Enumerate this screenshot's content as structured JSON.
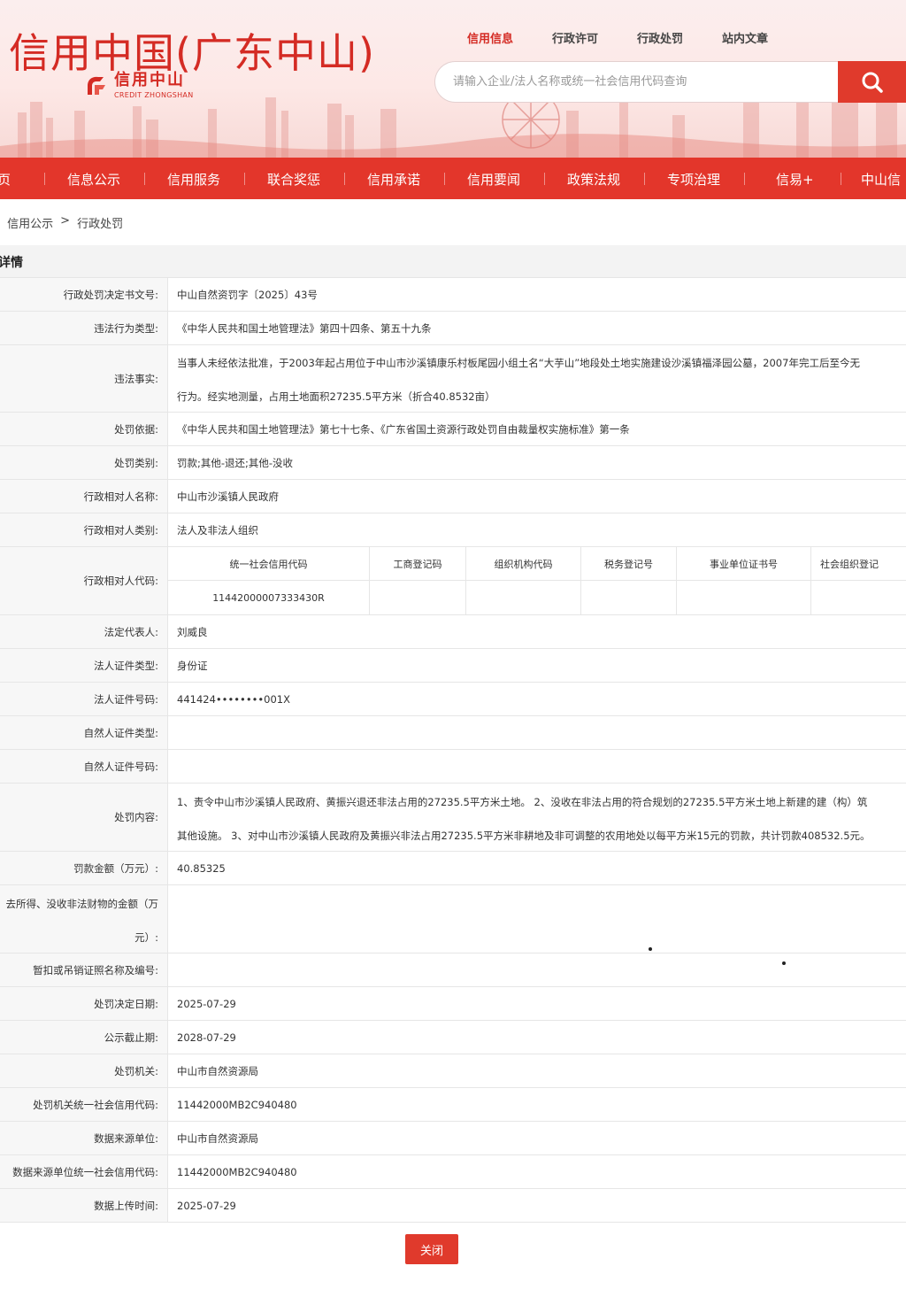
{
  "header": {
    "site_title": "信用中国(广东中山)",
    "logo_cn": "信用中山",
    "logo_en": "CREDIT ZHONGSHAN",
    "top_nav": [
      "信用信息",
      "行政许可",
      "行政处罚",
      "站内文章"
    ],
    "active_top_nav": "信用信息",
    "search_placeholder": "请输入企业/法人名称或统一社会信用代码查询"
  },
  "main_nav": [
    "页",
    "信息公示",
    "信用服务",
    "联合奖惩",
    "信用承诺",
    "信用要闻",
    "政策法规",
    "专项治理",
    "信易+",
    "中山信"
  ],
  "breadcrumb": [
    "信用公示",
    ">",
    "行政处罚"
  ],
  "breadcrumb_lead": "·",
  "detail_title": "详情",
  "rows": {
    "doc_no": {
      "label": "行政处罚决定书文号:",
      "value": "中山自然资罚字〔2025〕43号"
    },
    "violation_type": {
      "label": "违法行为类型:",
      "value": "《中华人民共和国土地管理法》第四十四条、第五十九条"
    },
    "facts": {
      "label": "违法事实:",
      "line1": "当事人未经依法批准，于2003年起占用位于中山市沙溪镇康乐村板尾园小组土名“大芋山”地段处土地实施建设沙溪镇福泽园公墓，2007年完工后至今无",
      "line2": "行为。经实地测量，占用土地面积27235.5平方米（折合40.8532亩）"
    },
    "basis": {
      "label": "处罚依据:",
      "value": "《中华人民共和国土地管理法》第七十七条、《广东省国土资源行政处罚自由裁量权实施标准》第一条"
    },
    "category": {
      "label": "处罚类别:",
      "value": "罚款;其他-退还;其他-没收"
    },
    "party_name": {
      "label": "行政相对人名称:",
      "value": "中山市沙溪镇人民政府"
    },
    "party_type": {
      "label": "行政相对人类别:",
      "value": "法人及非法人组织"
    },
    "party_code": {
      "label": "行政相对人代码:",
      "headers": [
        "统一社会信用代码",
        "工商登记码",
        "组织机构代码",
        "税务登记号",
        "事业单位证书号",
        "社会组织登记"
      ],
      "values": [
        "11442000007333430R",
        "",
        "",
        "",
        "",
        ""
      ]
    },
    "legal_rep": {
      "label": "法定代表人:",
      "value": "刘威良"
    },
    "legal_id_type": {
      "label": "法人证件类型:",
      "value": "身份证"
    },
    "legal_id_no": {
      "label": "法人证件号码:",
      "value": "441424••••••••001X"
    },
    "natural_id_type": {
      "label": "自然人证件类型:",
      "value": ""
    },
    "natural_id_no": {
      "label": "自然人证件号码:",
      "value": ""
    },
    "content": {
      "label": "处罚内容:",
      "line1": "1、责令中山市沙溪镇人民政府、黄振兴退还非法占用的27235.5平方米土地。 2、没收在非法占用的符合规划的27235.5平方米土地上新建的建（构）筑",
      "line2": "其他设施。 3、对中山市沙溪镇人民政府及黄振兴非法占用27235.5平方米非耕地及非可调整的农用地处以每平方米15元的罚款，共计罚款408532.5元。"
    },
    "fine": {
      "label": "罚款金额（万元）:",
      "value": "40.85325"
    },
    "confiscation": {
      "label_line1": "去所得、没收非法财物的金额（万",
      "label_line2": "元）:",
      "value": ""
    },
    "license": {
      "label": "暂扣或吊销证照名称及编号:",
      "value": ""
    },
    "decision_date": {
      "label": "处罚决定日期:",
      "value": "2025-07-29"
    },
    "publish_deadline": {
      "label": "公示截止期:",
      "value": "2028-07-29"
    },
    "authority": {
      "label": "处罚机关:",
      "value": "中山市自然资源局"
    },
    "authority_code": {
      "label": "处罚机关统一社会信用代码:",
      "value": "11442000MB2C940480"
    },
    "source_unit": {
      "label": "数据来源单位:",
      "value": "中山市自然资源局"
    },
    "source_code": {
      "label": "数据来源单位统一社会信用代码:",
      "value": "11442000MB2C940480"
    },
    "upload_time": {
      "label": "数据上传时间:",
      "value": "2025-07-29"
    }
  },
  "close_label": "关闭",
  "colors": {
    "brand_red": "#e3362b",
    "title_red": "#d42b24"
  },
  "icons": {
    "search": "search-icon",
    "logo": "credit-logo-icon"
  }
}
